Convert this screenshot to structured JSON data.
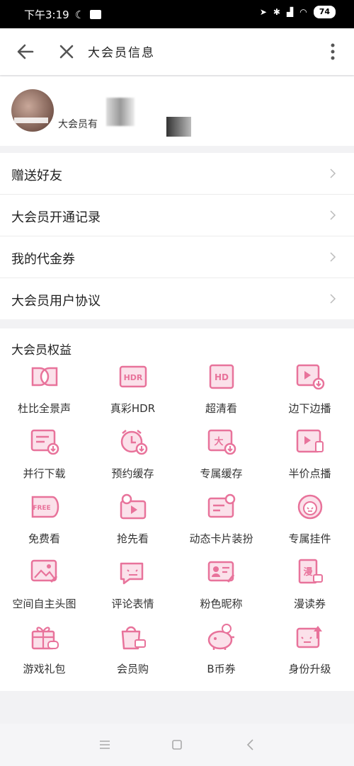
{
  "status_bar": {
    "time": "下午3:19",
    "battery": "74"
  },
  "toolbar": {
    "title": "大会员信息"
  },
  "profile": {
    "name_partial": "大会员有"
  },
  "menu": {
    "items": [
      {
        "label": "赠送好友"
      },
      {
        "label": "大会员开通记录"
      },
      {
        "label": "我的代金券"
      },
      {
        "label": "大会员用户协议"
      }
    ]
  },
  "benefits": {
    "title": "大会员权益",
    "items": [
      {
        "label": "杜比全景声",
        "icon": "dolby-icon"
      },
      {
        "label": "真彩HDR",
        "icon": "hdr-icon"
      },
      {
        "label": "超清看",
        "icon": "hd-icon"
      },
      {
        "label": "边下边播",
        "icon": "download-play-icon"
      },
      {
        "label": "并行下载",
        "icon": "parallel-download-icon"
      },
      {
        "label": "预约缓存",
        "icon": "alarm-cache-icon"
      },
      {
        "label": "专属缓存",
        "icon": "exclusive-cache-icon"
      },
      {
        "label": "半价点播",
        "icon": "half-price-icon"
      },
      {
        "label": "免费看",
        "icon": "free-icon"
      },
      {
        "label": "抢先看",
        "icon": "early-watch-icon"
      },
      {
        "label": "动态卡片装扮",
        "icon": "card-decor-icon"
      },
      {
        "label": "专属挂件",
        "icon": "pendant-icon"
      },
      {
        "label": "空间自主头图",
        "icon": "space-banner-icon"
      },
      {
        "label": "评论表情",
        "icon": "comment-emoji-icon"
      },
      {
        "label": "粉色昵称",
        "icon": "pink-name-icon"
      },
      {
        "label": "漫读券",
        "icon": "comic-coupon-icon"
      },
      {
        "label": "游戏礼包",
        "icon": "game-gift-icon"
      },
      {
        "label": "会员购",
        "icon": "member-shop-icon"
      },
      {
        "label": "B币券",
        "icon": "bcoin-icon"
      },
      {
        "label": "身份升级",
        "icon": "identity-upgrade-icon"
      }
    ]
  },
  "colors": {
    "accent": "#e8739b",
    "icon_fill": "#fbe1ea"
  }
}
